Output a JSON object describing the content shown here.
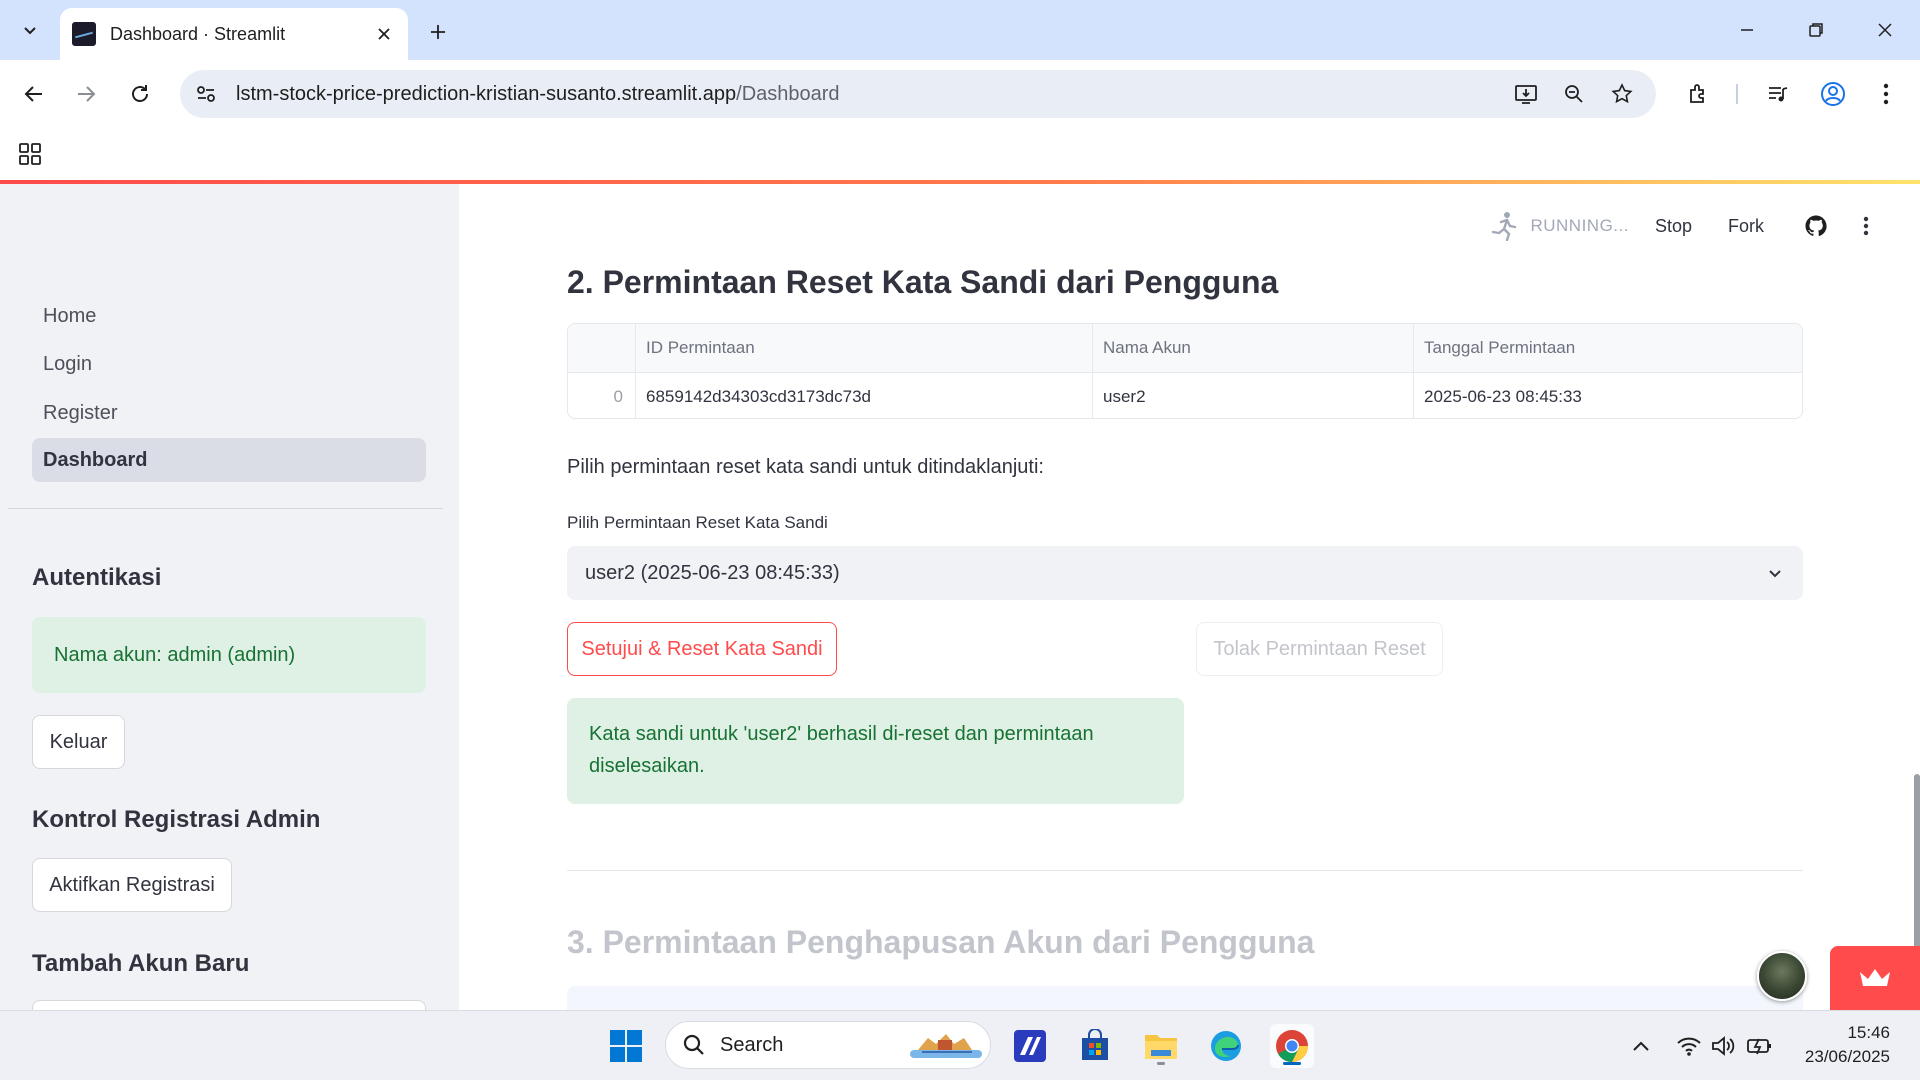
{
  "browser": {
    "tab_title": "Dashboard · Streamlit",
    "url_domain": "lstm-stock-price-prediction-kristian-susanto.streamlit.app",
    "url_path": "/Dashboard"
  },
  "sidebar": {
    "nav": [
      {
        "label": "Home"
      },
      {
        "label": "Login"
      },
      {
        "label": "Register"
      },
      {
        "label": "Dashboard",
        "active": true
      }
    ],
    "auth_heading": "Autentikasi",
    "account_text": "Nama akun: admin (admin)",
    "logout_label": "Keluar",
    "registration_heading": "Kontrol Registrasi Admin",
    "enable_registration_label": "Aktifkan Registrasi",
    "add_account_heading": "Tambah Akun Baru"
  },
  "header": {
    "status": "RUNNING...",
    "stop_label": "Stop",
    "fork_label": "Fork"
  },
  "section2": {
    "title": "2. Permintaan Reset Kata Sandi dari Pengguna",
    "table": {
      "columns": [
        "",
        "ID Permintaan",
        "Nama Akun",
        "Tanggal Permintaan"
      ],
      "rows": [
        [
          "0",
          "6859142d34303cd3173dc73d",
          "user2",
          "2025-06-23 08:45:33"
        ]
      ]
    },
    "prompt": "Pilih permintaan reset kata sandi untuk ditindaklanjuti:",
    "select_label": "Pilih Permintaan Reset Kata Sandi",
    "select_value": "user2 (2025-06-23 08:45:33)",
    "approve_label": "Setujui & Reset Kata Sandi",
    "reject_label": "Tolak Permintaan Reset",
    "success_message": "Kata sandi untuk 'user2' berhasil di-reset dan permintaan diselesaikan."
  },
  "section3": {
    "title": "3. Permintaan Penghapusan Akun dari Pengguna"
  },
  "taskbar": {
    "search_placeholder": "Search",
    "time": "15:46",
    "date": "23/06/2025"
  },
  "colors": {
    "accent": "#ff4b4b",
    "success_bg": "#dff0e4",
    "success_text": "#177233",
    "sidebar_bg": "#f0f2f6"
  }
}
